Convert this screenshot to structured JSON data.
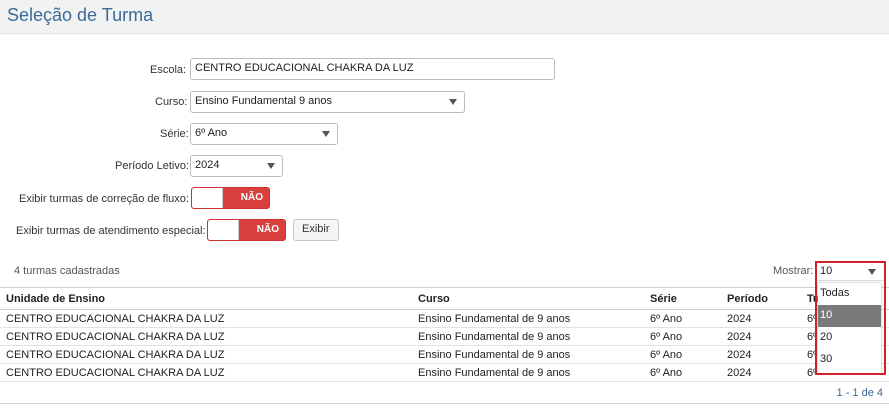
{
  "page": {
    "title": "Seleção de Turma"
  },
  "form": {
    "escola": {
      "label": "Escola:",
      "value": "CENTRO EDUCACIONAL CHAKRA DA LUZ"
    },
    "curso": {
      "label": "Curso:",
      "value": "Ensino Fundamental 9 anos"
    },
    "serie": {
      "label": "Série:",
      "value": "6º Ano"
    },
    "periodo": {
      "label": "Período Letivo:",
      "value": "2024"
    },
    "correcao": {
      "label": "Exibir turmas de correção de fluxo:",
      "state": "NÃO"
    },
    "atendimento": {
      "label": "Exibir turmas de atendimento especial:",
      "state": "NÃO"
    },
    "exibir_button": "Exibir"
  },
  "list": {
    "count_text": "4 turmas cadastradas",
    "show_label": "Mostrar:",
    "page_size": "10",
    "page_size_options": [
      "Todas",
      "10",
      "20",
      "30"
    ],
    "columns": [
      "Unidade de Ensino",
      "Curso",
      "Série",
      "Período",
      "Tu"
    ],
    "rows": [
      [
        "CENTRO EDUCACIONAL CHAKRA DA LUZ",
        "Ensino Fundamental de 9 anos",
        "6º Ano",
        "2024",
        "6º"
      ],
      [
        "CENTRO EDUCACIONAL CHAKRA DA LUZ",
        "Ensino Fundamental de 9 anos",
        "6º Ano",
        "2024",
        "6º"
      ],
      [
        "CENTRO EDUCACIONAL CHAKRA DA LUZ",
        "Ensino Fundamental de 9 anos",
        "6º Ano",
        "2024",
        "6º"
      ],
      [
        "CENTRO EDUCACIONAL CHAKRA DA LUZ",
        "Ensino Fundamental de 9 anos",
        "6º Ano",
        "2024",
        "6º"
      ]
    ],
    "pager": "1 - 1 de 4"
  },
  "colors": {
    "accent": "#3b6a9a",
    "toggle_off": "#d9403d",
    "highlight": "#d0202a"
  }
}
